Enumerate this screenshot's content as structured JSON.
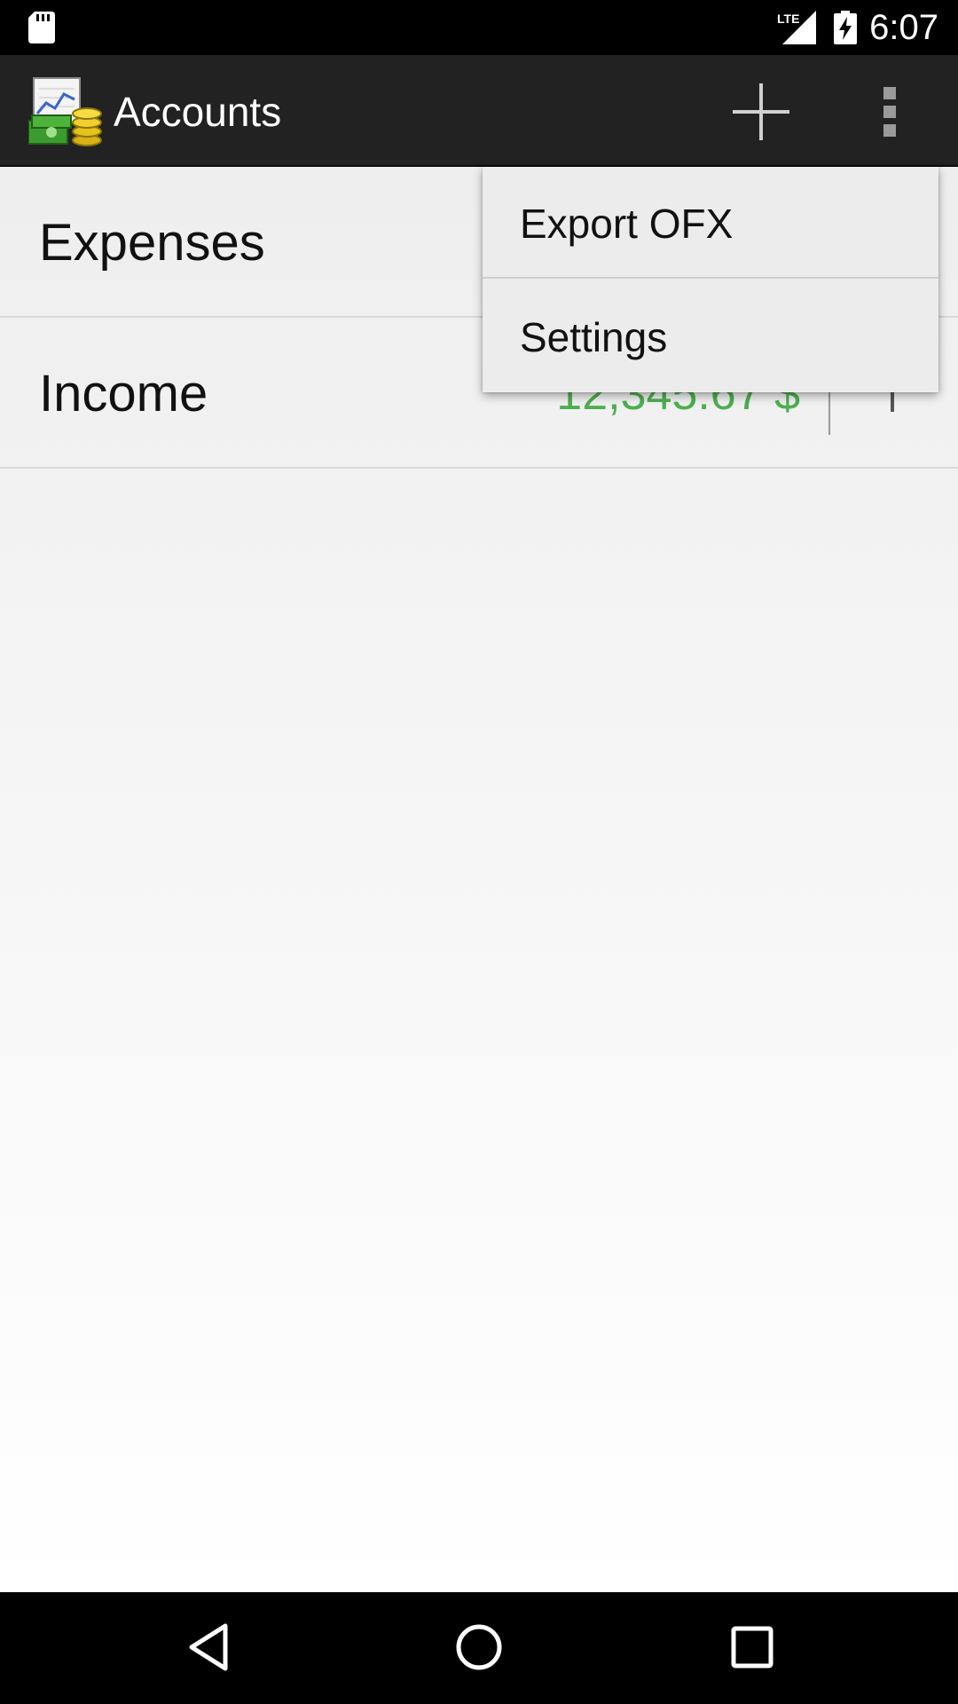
{
  "status_bar": {
    "time": "6:07",
    "network_label": "LTE",
    "icons": [
      "sd-card-icon",
      "lte-signal-icon",
      "battery-charging-icon"
    ]
  },
  "action_bar": {
    "title": "Accounts",
    "icons": [
      "app-logo-icon",
      "plus-icon",
      "overflow-menu-icon"
    ]
  },
  "accounts": [
    {
      "name": "Expenses",
      "balance": ""
    },
    {
      "name": "Income",
      "balance": "12,345.67 $"
    }
  ],
  "overflow_menu": {
    "items": [
      {
        "label": "Export OFX"
      },
      {
        "label": "Settings"
      }
    ]
  },
  "nav_bar": {
    "icons": [
      "back-icon",
      "home-icon",
      "recents-icon"
    ]
  },
  "colors": {
    "action_bar": "#222222",
    "positive_balance": "#4caf50",
    "menu_background": "#ececec",
    "content_top": "#eeeeee",
    "content_bottom": "#ffffff"
  }
}
